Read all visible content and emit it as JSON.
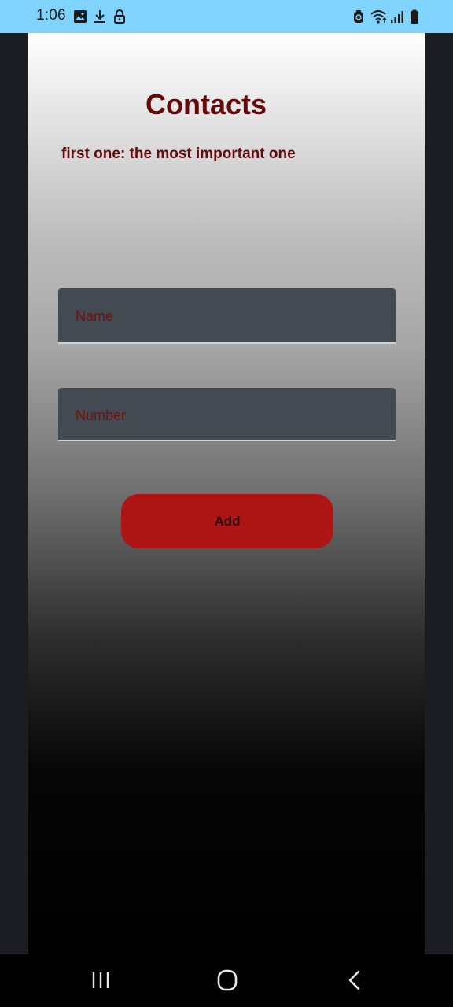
{
  "status_bar": {
    "time": "1:06",
    "background_color": "#7fd3fd",
    "left_icons": [
      "image-icon",
      "download-icon",
      "lock-icon"
    ],
    "right_icons": [
      "data-saver-icon",
      "wifi-icon",
      "cell-signal-icon",
      "battery-icon"
    ]
  },
  "main": {
    "title": "Contacts",
    "subtitle": "first one: the most important one",
    "title_color": "#640a0a",
    "name_field": {
      "placeholder": "Name",
      "value": ""
    },
    "number_field": {
      "placeholder": "Number",
      "value": ""
    },
    "add_button": {
      "label": "Add",
      "color": "#ae1515"
    }
  },
  "nav_bar": {
    "buttons": [
      "recents-icon",
      "home-icon",
      "back-icon"
    ]
  }
}
